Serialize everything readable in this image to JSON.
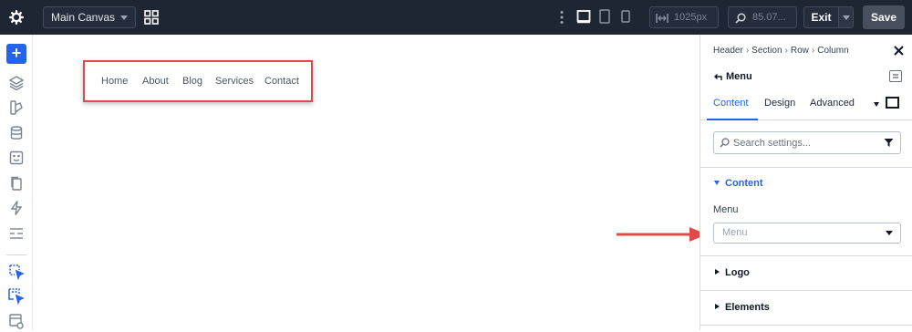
{
  "topbar": {
    "canvas_selector": "Main Canvas",
    "width_value": "1025px",
    "zoom_value": "85.07...",
    "exit_label": "Exit",
    "save_label": "Save"
  },
  "canvas": {
    "menu_items": [
      "Home",
      "About",
      "Blog",
      "Services",
      "Contact"
    ]
  },
  "panel": {
    "breadcrumb": [
      "Header",
      "Section",
      "Row",
      "Column"
    ],
    "title": "Menu",
    "tabs": [
      "Content",
      "Design",
      "Advanced"
    ],
    "active_tab": "Content",
    "search_placeholder": "Search settings...",
    "sections": {
      "content": {
        "label": "Content",
        "expanded": true
      },
      "logo": {
        "label": "Logo",
        "expanded": false
      },
      "elements": {
        "label": "Elements",
        "expanded": false
      }
    },
    "menu_field": {
      "label": "Menu",
      "selected": "Menu"
    }
  },
  "colors": {
    "topbar_bg": "#1e2533",
    "accent": "#2563eb",
    "highlight": "#e04a4a"
  },
  "icons": [
    "gear-icon",
    "grid-icon",
    "kebab-icon",
    "desktop-icon",
    "tablet-icon",
    "phone-icon",
    "width-icon",
    "zoom-icon",
    "plus-icon",
    "layers-icon",
    "shapes-icon",
    "database-icon",
    "template-icon",
    "pages-icon",
    "bolt-icon",
    "layout-icon",
    "select-icon",
    "select-multiple-icon",
    "element-icon",
    "close-icon",
    "back-icon",
    "toggle-icon",
    "search-icon",
    "filter-icon"
  ]
}
